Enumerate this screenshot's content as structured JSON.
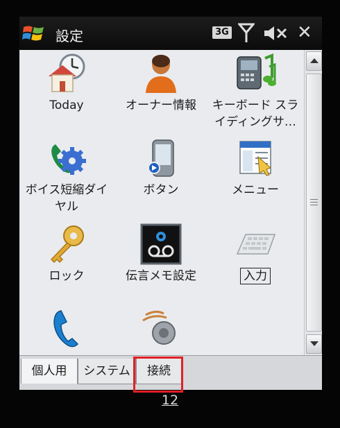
{
  "titlebar": {
    "title": "設定",
    "network_badge": "3G",
    "icons": [
      "windows-start-icon",
      "3g-icon",
      "signal-icon",
      "speaker-muted-icon",
      "close-icon"
    ],
    "close_glyph": "✕"
  },
  "grid": {
    "items": [
      {
        "label": "Today",
        "icon": "home-clock-icon"
      },
      {
        "label": "オーナー情報",
        "icon": "owner-person-icon"
      },
      {
        "label": "キーボード スラ\nイディングサ…",
        "icon": "sliding-keyboard-icon"
      },
      {
        "label": "ボイス短縮ダイ\nヤル",
        "icon": "voice-speed-dial-icon"
      },
      {
        "label": "ボタン",
        "icon": "buttons-icon"
      },
      {
        "label": "メニュー",
        "icon": "menus-icon"
      },
      {
        "label": "ロック",
        "icon": "key-lock-icon"
      },
      {
        "label": "伝言メモ設定",
        "icon": "voicemail-icon"
      },
      {
        "label": "入力",
        "icon": "keyboard-input-icon"
      },
      {
        "label": "",
        "icon": "phone-icon"
      },
      {
        "label": "",
        "icon": "sounds-icon"
      }
    ]
  },
  "tabs": [
    {
      "label": "個人用",
      "active": true
    },
    {
      "label": "システム",
      "active": false
    },
    {
      "label": "接続",
      "active": false
    }
  ],
  "highlighted_tab": "接続",
  "page_number": "12",
  "colors": {
    "highlight": "#e31f26",
    "titlebar": "#141414",
    "screen": "#e9ebee"
  }
}
